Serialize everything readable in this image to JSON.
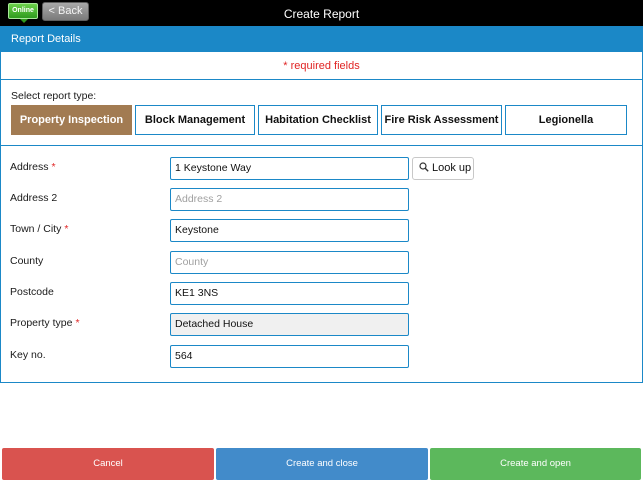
{
  "topbar": {
    "status_badge": "Online",
    "back_label": "< Back",
    "title": "Create Report"
  },
  "panel": {
    "header": "Report Details",
    "required_note": "* required fields"
  },
  "report_type": {
    "label": "Select report type:",
    "options": [
      {
        "label": "Property Inspection",
        "selected": true
      },
      {
        "label": "Block Management",
        "selected": false
      },
      {
        "label": "Habitation Checklist",
        "selected": false
      },
      {
        "label": "Fire Risk Assessment",
        "selected": false
      },
      {
        "label": "Legionella",
        "selected": false
      }
    ]
  },
  "form": {
    "required_marker": "*",
    "address": {
      "label": "Address",
      "value": "1 Keystone Way",
      "required": true
    },
    "lookup_label": "Look up",
    "address2": {
      "label": "Address 2",
      "placeholder": "Address 2"
    },
    "town": {
      "label": "Town / City",
      "value": "Keystone",
      "required": true
    },
    "county": {
      "label": "County",
      "placeholder": "County"
    },
    "postcode": {
      "label": "Postcode",
      "value": "KE1 3NS"
    },
    "property_type": {
      "label": "Property type",
      "value": "Detached House",
      "required": true
    },
    "key_no": {
      "label": "Key no.",
      "value": "564"
    }
  },
  "actions": {
    "cancel": "Cancel",
    "create_close": "Create and close",
    "create_open": "Create and open"
  },
  "icons": {
    "lookup": "magnifier-icon"
  },
  "colors": {
    "accent": "#1b88c7",
    "selected_type": "#a27b52",
    "required": "#e02424",
    "cancel": "#d9534f",
    "create_close": "#428bca",
    "create_open": "#5cb85c"
  }
}
